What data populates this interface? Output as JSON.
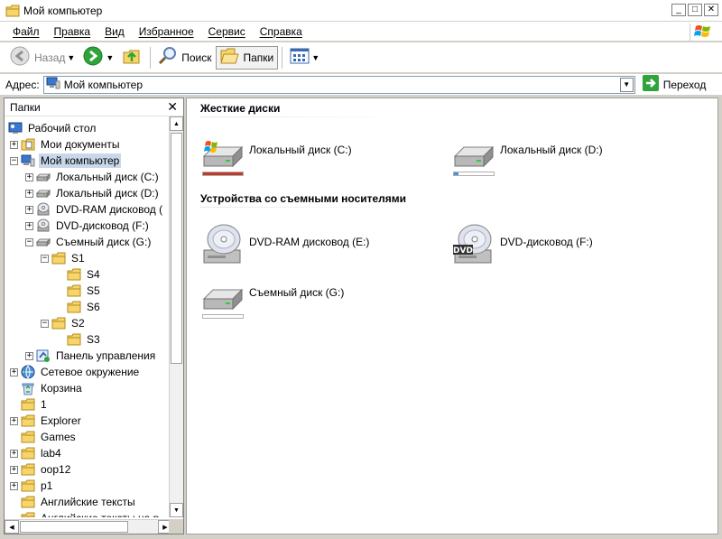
{
  "window": {
    "title": "Мой компьютер"
  },
  "menu": [
    "Файл",
    "Правка",
    "Вид",
    "Избранное",
    "Сервис",
    "Справка"
  ],
  "toolbar": {
    "back_label": "Назад",
    "search_label": "Поиск",
    "folders_label": "Папки"
  },
  "address": {
    "label": "Адрес:",
    "value": "Мой компьютер",
    "go_label": "Переход"
  },
  "folders_pane": {
    "title": "Папки",
    "items": [
      {
        "label": "Рабочий стол",
        "icon": "desktop-icon",
        "expander": "none"
      },
      {
        "label": "Мои документы",
        "icon": "documents-folder-icon",
        "expander": "plus"
      },
      {
        "label": "Мой компьютер",
        "icon": "computer-icon",
        "expander": "minus",
        "selected": true
      },
      {
        "label": "Локальный диск (C:)",
        "icon": "hard-disk-icon",
        "expander": "plus"
      },
      {
        "label": "Локальный диск (D:)",
        "icon": "hard-disk-icon",
        "expander": "plus"
      },
      {
        "label": "DVD-RAM дисковод (",
        "icon": "optical-drive-icon",
        "expander": "plus"
      },
      {
        "label": "DVD-дисковод (F:)",
        "icon": "optical-drive-icon",
        "expander": "plus"
      },
      {
        "label": "Съемный диск (G:)",
        "icon": "removable-disk-icon",
        "expander": "minus"
      },
      {
        "label": "S1",
        "icon": "folder-icon",
        "expander": "minus"
      },
      {
        "label": "S4",
        "icon": "folder-icon",
        "expander": "none"
      },
      {
        "label": "S5",
        "icon": "folder-icon",
        "expander": "none"
      },
      {
        "label": "S6",
        "icon": "folder-icon",
        "expander": "none"
      },
      {
        "label": "S2",
        "icon": "folder-icon",
        "expander": "minus"
      },
      {
        "label": "S3",
        "icon": "folder-icon",
        "expander": "none"
      },
      {
        "label": "Панель управления",
        "icon": "control-panel-icon",
        "expander": "plus"
      },
      {
        "label": "Сетевое окружение",
        "icon": "network-icon",
        "expander": "plus"
      },
      {
        "label": "Корзина",
        "icon": "recycle-bin-icon",
        "expander": "none"
      },
      {
        "label": "1",
        "icon": "folder-icon",
        "expander": "none"
      },
      {
        "label": "Explorer",
        "icon": "folder-icon",
        "expander": "plus"
      },
      {
        "label": "Games",
        "icon": "folder-icon",
        "expander": "none"
      },
      {
        "label": "lab4",
        "icon": "folder-icon",
        "expander": "plus"
      },
      {
        "label": "oop12",
        "icon": "folder-icon",
        "expander": "plus"
      },
      {
        "label": "p1",
        "icon": "folder-icon",
        "expander": "plus"
      },
      {
        "label": "Английские тексты",
        "icon": "folder-icon",
        "expander": "none"
      },
      {
        "label": "Английские тексты на р",
        "icon": "folder-icon",
        "expander": "none"
      }
    ]
  },
  "content": {
    "groups": [
      {
        "title": "Жесткие диски",
        "items": [
          {
            "name": "Локальный диск (C:)",
            "icon": "system-hard-disk-icon",
            "used_fraction": 1.0,
            "bar_color": "#c0392b"
          },
          {
            "name": "Локальный диск (D:)",
            "icon": "hard-disk-icon",
            "used_fraction": 0.12,
            "bar_color": "#4a90d9"
          }
        ]
      },
      {
        "title": "Устройства со съемными носителями",
        "items": [
          {
            "name": "DVD-RAM дисковод (E:)",
            "icon": "dvd-ram-drive-icon"
          },
          {
            "name": "DVD-дисковод (F:)",
            "icon": "dvd-drive-icon",
            "badge": "DVD"
          },
          {
            "name": "Съемный диск (G:)",
            "icon": "removable-disk-icon",
            "used_fraction": 0.0,
            "bar_color": "#4a90d9"
          }
        ]
      }
    ]
  }
}
